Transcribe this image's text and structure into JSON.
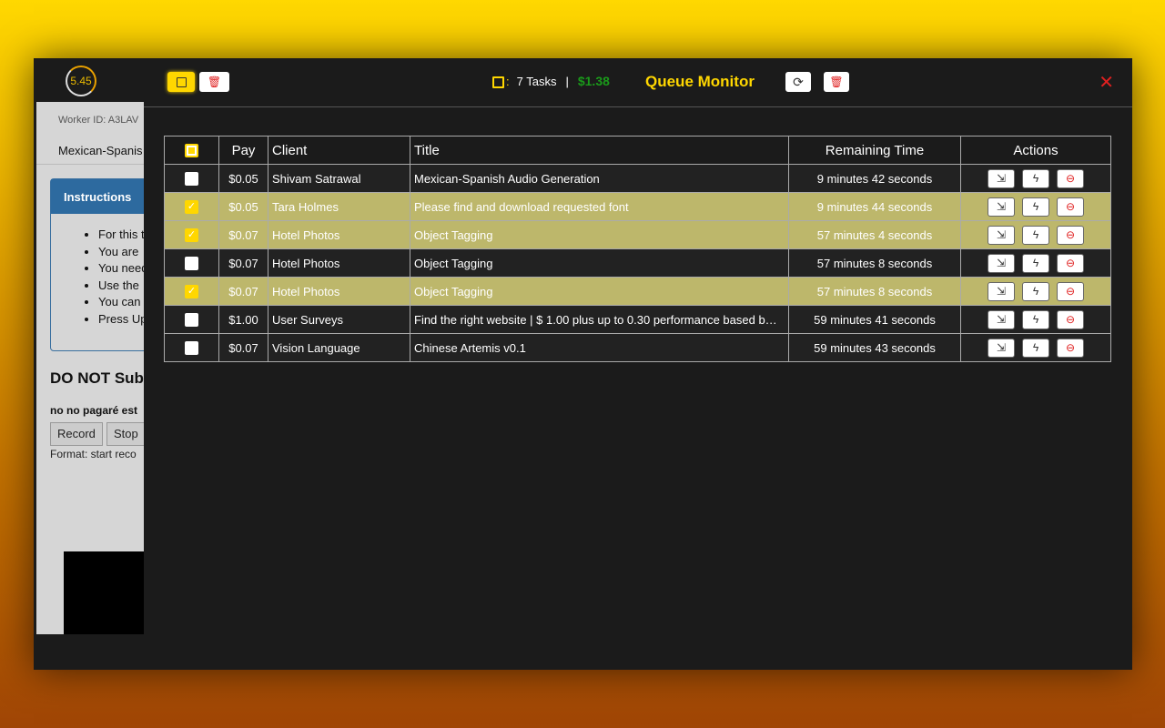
{
  "background_page": {
    "timer": "5.45",
    "worker_id": "Worker ID: A3LAV",
    "task_title": "Mexican-Spanis",
    "instructions_title": "Instructions",
    "instructions": [
      "For this t",
      "You are",
      "You need",
      "Use the",
      "You can",
      "Press Up"
    ],
    "warning": "DO NOT Sub",
    "note": "no no pagaré est",
    "record_label": "Record",
    "stop_label": "Stop",
    "format": "Format: start reco"
  },
  "header": {
    "title": "Queue Monitor",
    "task_count": "7 Tasks",
    "separator": "|",
    "total": "$1.38",
    "colon": ":",
    "close": "✕"
  },
  "colors": {
    "accent": "#ffd700",
    "total": "#1a9a1a",
    "selected_row": "#bdb76b",
    "danger": "#e02020"
  },
  "table": {
    "columns": [
      "Pay",
      "Client",
      "Title",
      "Remaining Time",
      "Actions"
    ],
    "rows": [
      {
        "checked": false,
        "pay": "$0.05",
        "client": "Shivam Satrawal",
        "title": "Mexican-Spanish Audio Generation",
        "time": "9 minutes 42 seconds"
      },
      {
        "checked": true,
        "pay": "$0.05",
        "client": "Tara Holmes",
        "title": "Please find and download requested font",
        "time": "9 minutes 44 seconds"
      },
      {
        "checked": true,
        "pay": "$0.07",
        "client": "Hotel Photos",
        "title": "Object Tagging",
        "time": "57 minutes 4 seconds"
      },
      {
        "checked": false,
        "pay": "$0.07",
        "client": "Hotel Photos",
        "title": "Object Tagging",
        "time": "57 minutes 8 seconds"
      },
      {
        "checked": true,
        "pay": "$0.07",
        "client": "Hotel Photos",
        "title": "Object Tagging",
        "time": "57 minutes 8 seconds"
      },
      {
        "checked": false,
        "pay": "$1.00",
        "client": "User Surveys",
        "title": "Find the right website | $ 1.00 plus up to 0.30 performance based b…",
        "time": "59 minutes 41 seconds"
      },
      {
        "checked": false,
        "pay": "$0.07",
        "client": "Vision Language",
        "title": "Chinese Artemis v0.1",
        "time": "59 minutes 43 seconds"
      }
    ]
  }
}
